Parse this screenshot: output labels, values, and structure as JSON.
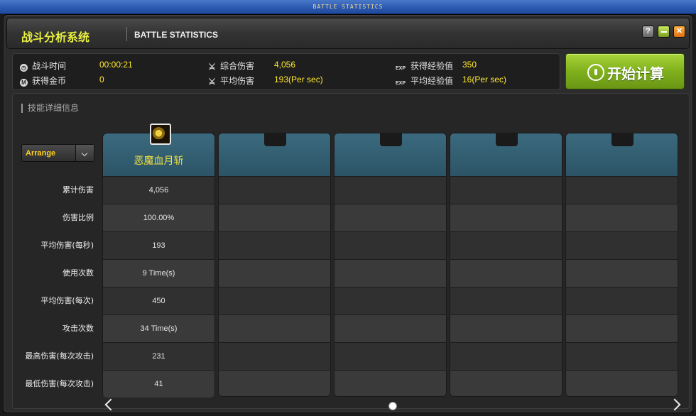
{
  "window_title": "BATTLE STATISTICS",
  "header": {
    "title_cn": "战斗分析系统",
    "title_en": "BATTLE STATISTICS",
    "help_label": "?"
  },
  "stats": {
    "battle_time": {
      "label": "战斗时间",
      "value": "00:00:21"
    },
    "gold": {
      "label": "获得金币",
      "value": "0"
    },
    "total_damage": {
      "label": "综合伤害",
      "value": "4,056"
    },
    "avg_damage": {
      "label": "平均伤害",
      "value": "193(Per sec)"
    },
    "exp_gained": {
      "label": "获得经验值",
      "value": "350"
    },
    "avg_exp": {
      "label": "平均经验值",
      "value": "16(Per sec)"
    },
    "exp_tag": "EXP",
    "time_icon_char": "◷",
    "gold_icon_char": "M",
    "sword_icon_char": "⚔"
  },
  "calc_button": {
    "label": "开始计算"
  },
  "detail": {
    "title": "技能详细信息",
    "arrange_label": "Arrange",
    "row_labels": [
      "累计伤害",
      "伤害比例",
      "平均伤害(每秒)",
      "使用次数",
      "平均伤害(每次)",
      "攻击次数",
      "最高伤害(每次攻击)",
      "最低伤害(每次攻击)"
    ],
    "skills": [
      {
        "name": "恶魔血月斩",
        "values": [
          "4,056",
          "100.00%",
          "193",
          "9 Time(s)",
          "450",
          "34 Time(s)",
          "231",
          "41"
        ]
      }
    ]
  },
  "colors": {
    "accent_yellow": "#ffe830",
    "header_teal": "#2c5466",
    "button_green": "#7fb01c"
  }
}
